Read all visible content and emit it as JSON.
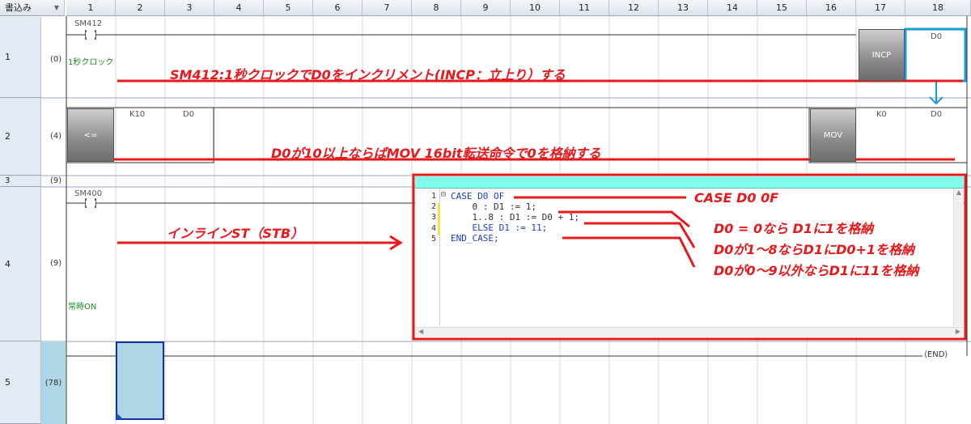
{
  "toolbar": {
    "mode_label": "書込み"
  },
  "columns": [
    "1",
    "2",
    "3",
    "4",
    "5",
    "6",
    "7",
    "8",
    "9",
    "10",
    "11",
    "12",
    "13",
    "14",
    "15",
    "16",
    "17",
    "18"
  ],
  "rows": [
    {
      "num": "1",
      "step": "(0)"
    },
    {
      "num": "2",
      "step": "(4)"
    },
    {
      "num": "3",
      "step": "(9)"
    },
    {
      "num": "4",
      "step": "(9)"
    },
    {
      "num": "5",
      "step": "(78)"
    }
  ],
  "rung1": {
    "contact_device": "SM412",
    "contact_comment": "1秒クロック",
    "instruction": "INCP",
    "operand": "D0"
  },
  "rung2": {
    "compare_op": "<=",
    "operand1": "K10",
    "operand2": "D0",
    "instruction": "MOV",
    "src": "K0",
    "dst": "D0"
  },
  "rung3": {
    "contact_device": "SM400",
    "contact_comment": "常時ON"
  },
  "end_label": "END",
  "st_code": {
    "line_numbers": [
      "1",
      "2",
      "3",
      "4",
      "5"
    ],
    "lines": [
      "CASE D0 OF",
      "    0 : D1 := 1;",
      "    1..8 : D1 := D0 + 1;",
      "    ELSE D1 := 11;",
      "END_CASE;"
    ],
    "fold_marker": "⊟"
  },
  "annotations": {
    "rung1": "SM412:1秒クロックでD0をインクリメント(INCP：立上り）する",
    "rung2": "D0が10以上ならばMOV 16bit転送命令で0を格納する",
    "inline_st": "インラインST（STB）",
    "case": "CASE D0 0F",
    "line2": "D0 = 0なら D1に1を格納",
    "line3": "D0が1～8ならD1にD0+1を格納",
    "line4": "D0が0～9以外ならD1に11を格納"
  },
  "colors": {
    "annotation_red": "#e8191c",
    "header_bg": "#dde3ec",
    "selection_blue": "#1a9ad6",
    "st_header_cyan": "#7fffea",
    "cell_select": "#aed6e6"
  }
}
